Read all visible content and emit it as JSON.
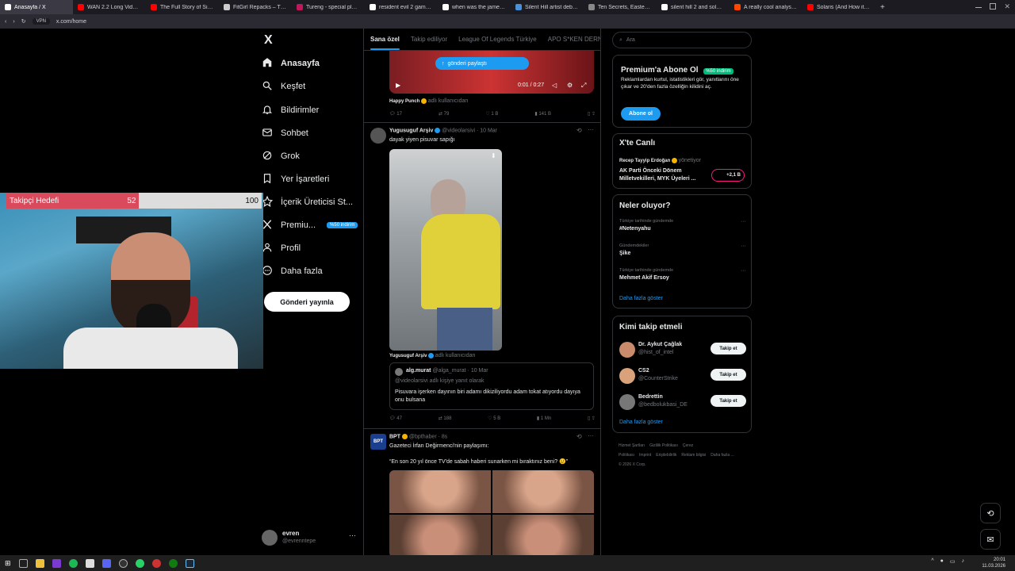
{
  "browser": {
    "tabs": [
      {
        "label": "Anasayfa / X",
        "color": "#ffffff",
        "active": true
      },
      {
        "label": "WAN 2.2 Long Video Gen",
        "color": "#ff0000"
      },
      {
        "label": "The Full Story of Silent Hill",
        "color": "#ff0000"
      },
      {
        "label": "FitGirl Repacks – The ON",
        "color": "#cccccc"
      },
      {
        "label": "Tureng - special place - T",
        "color": "#c2185b"
      },
      {
        "label": "resident evil 2 game relea",
        "color": "#ffffff"
      },
      {
        "label": "when was the james sund",
        "color": "#ffffff"
      },
      {
        "label": "Silent Hill artist debunks h",
        "color": "#4a90d9"
      },
      {
        "label": "Ten Secrets, Easter Eggs",
        "color": "#888888"
      },
      {
        "label": "silent hill 2 and solaris - G",
        "color": "#ffffff"
      },
      {
        "label": "A really cool analysis of th",
        "color": "#ff4500"
      },
      {
        "label": "Solaris (And How it Influen",
        "color": "#ff0000"
      }
    ],
    "url": "x.com/home",
    "vpn_label": "VPN"
  },
  "stream": {
    "goal_label": "Takipçi Hedefi",
    "goal_current": "52",
    "goal_max": "100",
    "goal_fraction": 0.52
  },
  "nav": {
    "logo": "X",
    "items": [
      {
        "label": "Anasayfa",
        "icon": "home-icon"
      },
      {
        "label": "Keşfet",
        "icon": "search-icon"
      },
      {
        "label": "Bildirimler",
        "icon": "bell-icon"
      },
      {
        "label": "Sohbet",
        "icon": "mail-icon"
      },
      {
        "label": "Grok",
        "icon": "grok-icon"
      },
      {
        "label": "Yer İşaretleri",
        "icon": "bookmark-icon"
      },
      {
        "label": "İçerik Üreticisi St...",
        "icon": "creator-icon"
      },
      {
        "label": "Premiu...",
        "icon": "x-icon",
        "badge": "%50 indirim"
      },
      {
        "label": "Profil",
        "icon": "person-icon"
      },
      {
        "label": "Daha fazla",
        "icon": "more-icon"
      }
    ],
    "post_button": "Gönderi yayınla",
    "user_name": "evren",
    "user_handle": "@evrenntepe"
  },
  "feed": {
    "tabs": [
      "Sana özel",
      "Takip ediliyor",
      "League Of Legends Türkiye",
      "APO S*KEN DERNE"
    ],
    "post1": {
      "share_label": "gönderi paylaştı",
      "time": "0:01 / 0:27",
      "source_name": "Happy Punch",
      "source_suffix": "adlı kullanıcıdan",
      "replies": "17",
      "reposts": "79",
      "likes": "1 B",
      "views": "141 B"
    },
    "post2": {
      "author": "Yugusuguf Arşiv",
      "handle": "@videolarsivi · 10 Mar",
      "text": "dayak yiyen pisuvar sapığı",
      "source_name": "Yugusuguf Arşiv",
      "source_suffix": "adlı kullanıcıdan",
      "quote_author": "alg.murat",
      "quote_handle": "@alga_murat · 10 Mar",
      "quote_reply": "@videolarsivi adlı kişiye yanıt olarak",
      "quote_text": "Pisuvara işerken dayının biri adamı dikiziliyordu adam tokat atıyordu dayıya onu bulsana",
      "replies": "47",
      "reposts": "188",
      "likes": "5 B",
      "views": "1 Mn"
    },
    "post3": {
      "author": "BPT",
      "handle": "@bpthaber · 8s",
      "avatar_text": "BPT",
      "line1": "Gazeteci İrfan Değirmenci'nin paylaşımı:",
      "line2": "“En son 20 yıl önce TV'de sabah haberi sunarken mi bıraktınız beni? 😢”"
    }
  },
  "right": {
    "search_placeholder": "Ara",
    "premium": {
      "title": "Premium'a Abone Ol",
      "badge": "%50 indirim",
      "text": "Reklamlardan kurtul, istatistikleri gör, yanıtlarını öne çıkar ve 20'den fazla özelliğin kilidini aç.",
      "button": "Abone ol"
    },
    "live": {
      "title": "X'te Canlı",
      "host": "Recep Tayyip Erdoğan",
      "host_suffix": "yönetiyor",
      "topic": "AK Parti Önceki Dönem Milletvekilleri, MYK Üyeleri ...",
      "listeners": "+2,1 B"
    },
    "trends": {
      "title": "Neler oluyor?",
      "items": [
        {
          "context": "Türkiye tarihinde gündemde",
          "name": "#Netenyahu"
        },
        {
          "context": "Gündemdekiler",
          "name": "Şike"
        },
        {
          "context": "Türkiye tarihinde gündemde",
          "name": "Mehmet Akif Ersoy"
        }
      ],
      "show_more": "Daha fazla göster"
    },
    "who_to_follow": {
      "title": "Kimi takip etmeli",
      "users": [
        {
          "name": "Dr. Aykut Çağlak",
          "handle": "@hist_of_intel",
          "avatar": "#c98b6b"
        },
        {
          "name": "CS2",
          "handle": "@CounterStrike",
          "avatar": "#d9a27a"
        },
        {
          "name": "Bedrettin",
          "handle": "@bedbolukbasi_DE",
          "avatar": "#777777"
        }
      ],
      "follow_label": "Takip et",
      "show_more": "Daha fazla göster"
    },
    "footer": {
      "links": [
        "Hizmet Şartları",
        "Gizlilik Politikası",
        "Çerez Politikası",
        "Imprint",
        "Erişilebilirlik",
        "Reklam bilgisi",
        "Daha fazla ..."
      ],
      "copyright": "© 2026 X Corp."
    }
  },
  "taskbar": {
    "time": "20:01",
    "date": "11.03.2026"
  }
}
